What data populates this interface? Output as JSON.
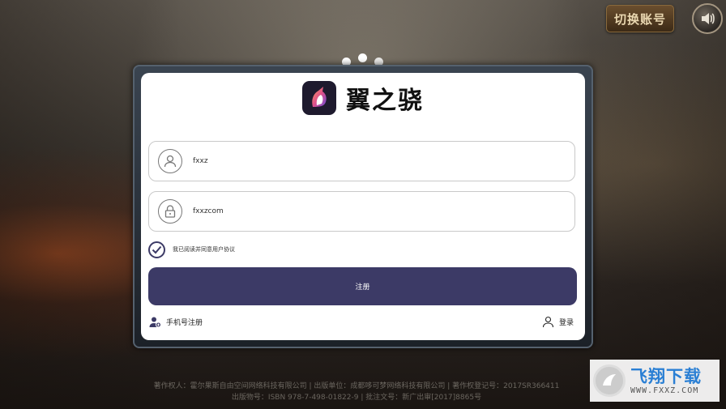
{
  "top_bar": {
    "switch_account_label": "切换账号",
    "sound_icon": "speaker-icon"
  },
  "login_panel": {
    "app_name": "翼之骁",
    "app_icon": "unicorn-logo-icon",
    "username": {
      "value": "fxxz",
      "icon": "user-icon"
    },
    "password": {
      "value": "fxxzcom",
      "icon": "lock-icon"
    },
    "agreement_label": "我已阅读并同意用户协议",
    "agreement_checked": true,
    "submit_label": "注册",
    "phone_register_label": "手机号注册",
    "login_label": "登录"
  },
  "footer": {
    "line1": "著作权人：霍尔果斯自由空间网络科技有限公司 | 出版单位：成都哆可梦网络科技有限公司 | 著作权登记号：2017SR366411",
    "line2": "出版物号：ISBN 978-7-498-01822-9 | 批注文号：新广出审[2017]8865号"
  },
  "watermark": {
    "title": "飞翔下载",
    "url": "WWW.FXXZ.COM"
  },
  "colors": {
    "accent": "#3c3a66",
    "switch_button": "#4e3920",
    "watermark_blue": "#2a7fd4"
  }
}
